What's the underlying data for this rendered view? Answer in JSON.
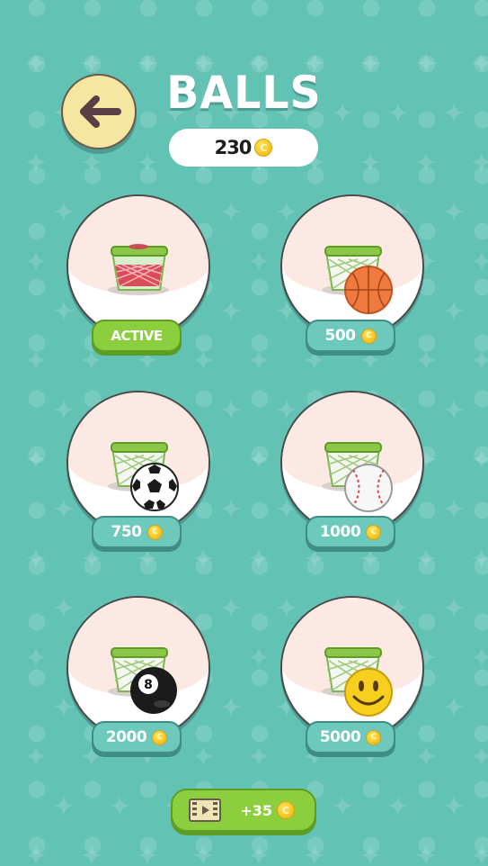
{
  "header": {
    "title": "BALLS",
    "coin_balance": "230"
  },
  "items": [
    {
      "ball": "basketball-red-net",
      "label": "ACTIVE",
      "state": "active"
    },
    {
      "ball": "basketball",
      "label": "500",
      "state": "locked"
    },
    {
      "ball": "soccer-ball",
      "label": "750",
      "state": "locked"
    },
    {
      "ball": "baseball",
      "label": "1000",
      "state": "locked"
    },
    {
      "ball": "eight-ball",
      "label": "2000",
      "state": "locked"
    },
    {
      "ball": "smiley-ball",
      "label": "5000",
      "state": "locked"
    }
  ],
  "reward_button": {
    "label": "+35",
    "icon": "video-film-icon"
  },
  "colors": {
    "background": "#62c2b4",
    "active_green": "#8ccf3e",
    "price_teal": "#6cc9bb",
    "coin_gold": "#f2c01a"
  }
}
